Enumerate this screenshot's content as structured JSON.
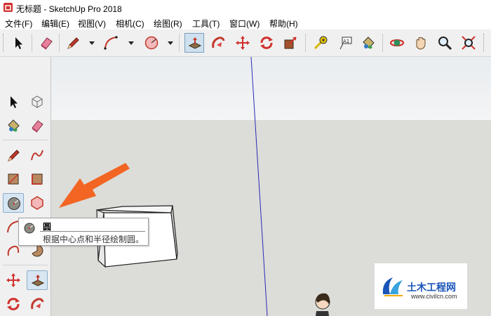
{
  "window": {
    "title": "无标题 - SketchUp Pro 2018"
  },
  "menu": [
    "文件(F)",
    "编辑(E)",
    "视图(V)",
    "相机(C)",
    "绘图(R)",
    "工具(T)",
    "窗口(W)",
    "帮助(H)"
  ],
  "tooltip": {
    "title": "圆",
    "description": "根据中心点和半径绘制圆。"
  },
  "watermark": {
    "title": "土木工程网",
    "url": "www.civilcn.com"
  },
  "colors": {
    "arrow": "#f26522",
    "axis_blue": "#2b2bb5",
    "ground": "#dcdcd8",
    "sky": "#eef0f2"
  }
}
